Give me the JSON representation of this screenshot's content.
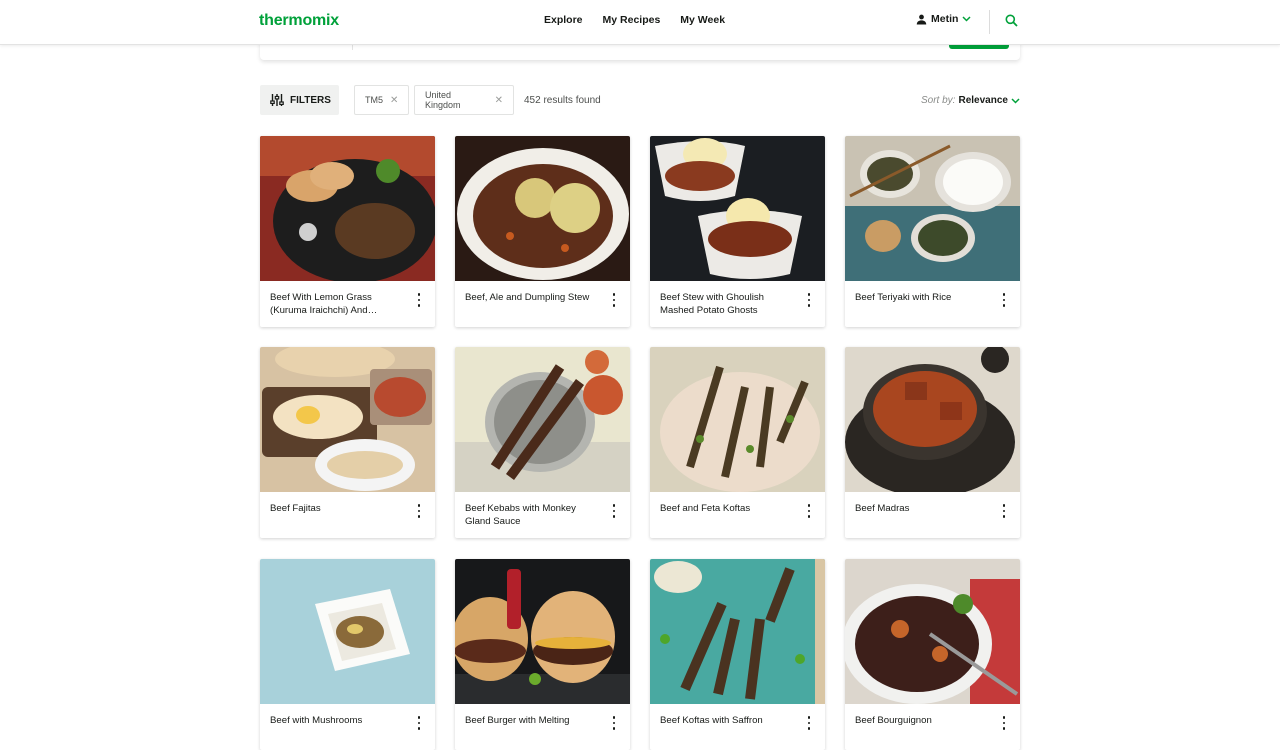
{
  "header": {
    "logo": "thermomix",
    "nav": [
      "Explore",
      "My Recipes",
      "My Week"
    ],
    "user": "Metin"
  },
  "filters": {
    "button": "FILTERS",
    "chips": [
      "TM5",
      "United Kingdom"
    ],
    "results": "452 results found",
    "sort_label": "Sort by:",
    "sort_value": "Relevance"
  },
  "recipes": [
    {
      "title": "Beef With Lemon Grass (Kuruma Iraichchi) And…"
    },
    {
      "title": "Beef, Ale and Dumpling Stew"
    },
    {
      "title": "Beef Stew with Ghoulish Mashed Potato Ghosts"
    },
    {
      "title": "Beef Teriyaki with Rice"
    },
    {
      "title": "Beef Fajitas"
    },
    {
      "title": "Beef Kebabs with Monkey Gland Sauce"
    },
    {
      "title": "Beef and Feta Koftas"
    },
    {
      "title": "Beef Madras"
    },
    {
      "title": "Beef with Mushrooms"
    },
    {
      "title": "Beef Burger with Melting"
    },
    {
      "title": "Beef Koftas with Saffron"
    },
    {
      "title": "Beef Bourguignon"
    }
  ],
  "colors": {
    "brand": "#00a13a",
    "text": "#171a17"
  }
}
